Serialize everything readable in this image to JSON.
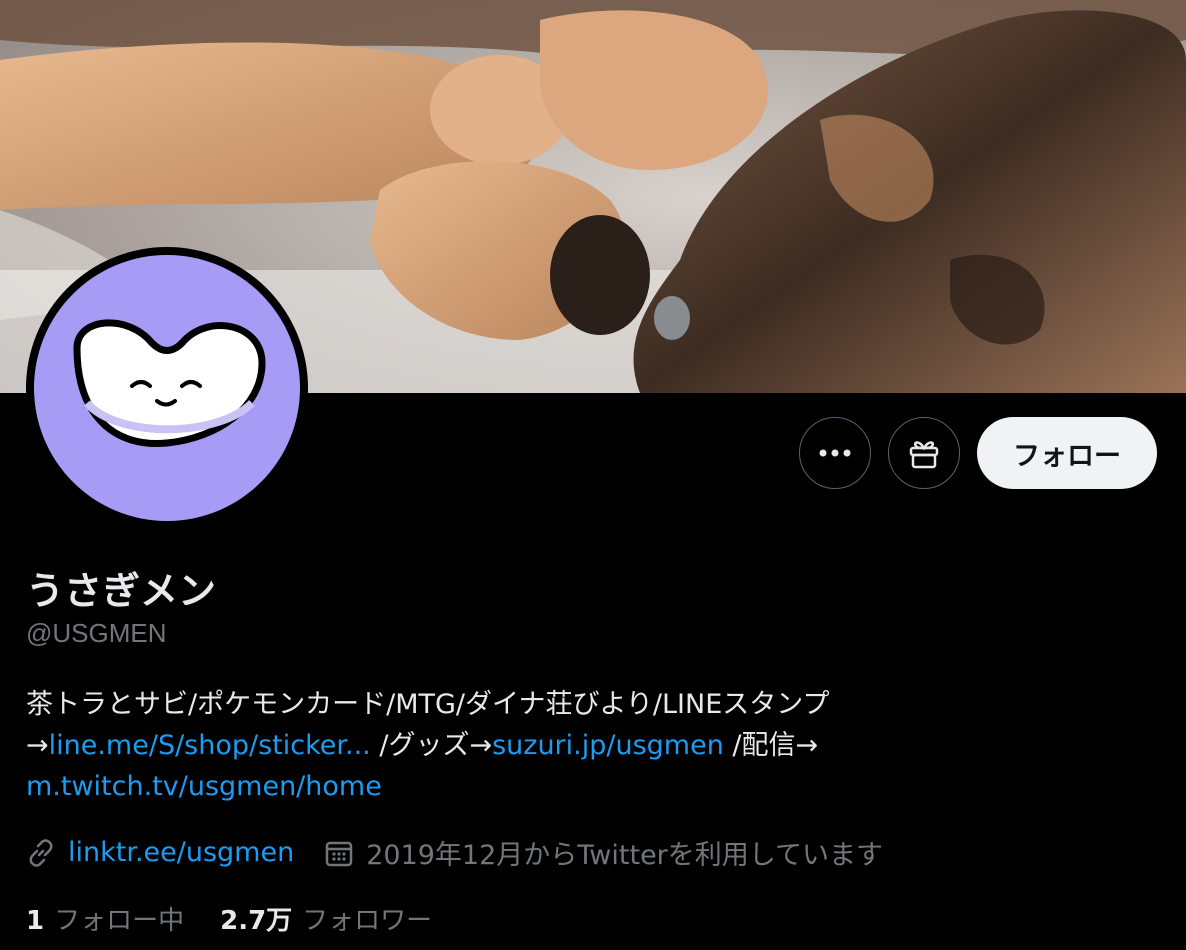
{
  "profile": {
    "display_name": "うさぎメン",
    "handle": "@USGMEN",
    "bio": {
      "line1": "茶トラとサビ/ポケモンカード/MTG/ダイナ荘びより/LINEスタンプ",
      "arrow1": "→",
      "link_line": "line.me/S/shop/sticker...",
      "goods": " /グッズ→",
      "link_suzuri": "suzuri.jp/usgmen",
      "stream": " /配信→",
      "link_twitch": "m.twitch.tv/usgmen/home"
    },
    "website": "linktr.ee/usgmen",
    "joined": "2019年12月からTwitterを利用しています",
    "following_count": "1",
    "following_label": "フォロー中",
    "followers_count": "2.7万",
    "followers_label": "フォロワー"
  },
  "actions": {
    "more_icon": "more-icon",
    "gift_icon": "gift-icon",
    "follow_label": "フォロー"
  },
  "colors": {
    "background": "#000000",
    "link": "#1d9bf0",
    "secondary_text": "#71767b",
    "avatar_bg": "#a79cf5",
    "follow_button_bg": "#eff3f4"
  }
}
